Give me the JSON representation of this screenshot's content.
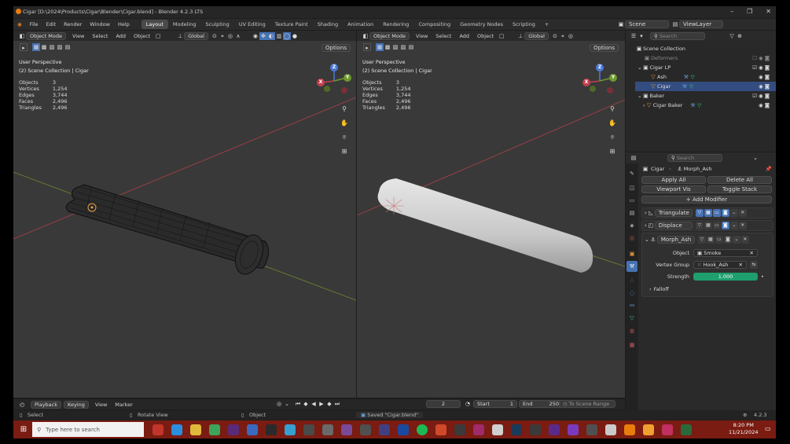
{
  "window": {
    "title": "Cigar [D:\\2024\\Products\\Cigar\\Blender\\Cigar.blend] - Blender 4.2.3 LTS"
  },
  "menus": [
    "File",
    "Edit",
    "Render",
    "Window",
    "Help"
  ],
  "workspaces": [
    "Layout",
    "Modeling",
    "Sculpting",
    "UV Editing",
    "Texture Paint",
    "Shading",
    "Animation",
    "Rendering",
    "Compositing",
    "Geometry Nodes",
    "Scripting"
  ],
  "active_workspace": "Layout",
  "scene": {
    "name": "Scene",
    "view_layer": "ViewLayer"
  },
  "viewport_left": {
    "mode": "Object Mode",
    "menus": [
      "View",
      "Select",
      "Add",
      "Object"
    ],
    "transform": "Global",
    "options": "Options",
    "perspective": "User Perspective",
    "collection": "(2) Scene Collection | Cigar",
    "stats": [
      [
        "Objects",
        "3"
      ],
      [
        "Vertices",
        "1,254"
      ],
      [
        "Edges",
        "3,744"
      ],
      [
        "Faces",
        "2,496"
      ],
      [
        "Triangles",
        "2,496"
      ]
    ]
  },
  "viewport_right": {
    "mode": "Object Mode",
    "menus": [
      "View",
      "Select",
      "Add",
      "Object"
    ],
    "transform": "Global",
    "options": "Options",
    "perspective": "User Perspective",
    "collection": "(2) Scene Collection | Cigar",
    "stats": [
      [
        "Objects",
        "3"
      ],
      [
        "Vertices",
        "1,254"
      ],
      [
        "Edges",
        "3,744"
      ],
      [
        "Faces",
        "2,496"
      ],
      [
        "Triangles",
        "2,496"
      ]
    ]
  },
  "gizmo_labels": {
    "x": "X",
    "y": "Y",
    "z": "Z"
  },
  "outliner": {
    "search_placeholder": "Search",
    "items": [
      {
        "label": "Scene Collection",
        "indent": 0
      },
      {
        "label": "Deformers",
        "indent": 1
      },
      {
        "label": "Cigar LP",
        "indent": 1
      },
      {
        "label": "Ash",
        "indent": 2
      },
      {
        "label": "Cigar",
        "indent": 2
      },
      {
        "label": "Baker",
        "indent": 1
      },
      {
        "label": "Cigar Baker",
        "indent": 2
      }
    ]
  },
  "properties": {
    "search_placeholder": "Search",
    "breadcrumb_object": "Cigar",
    "breadcrumb_modifier": "Morph_Ash",
    "apply_all": "Apply All",
    "delete_all": "Delete All",
    "viewport_vis": "Viewport Vis",
    "toggle_stack": "Toggle Stack",
    "add_modifier": "Add Modifier",
    "modifiers": [
      "Triangulate",
      "Displace",
      "Morph_Ash"
    ],
    "object_label": "Object",
    "object_value": "Smoke",
    "vgroup_label": "Vertex Group",
    "vgroup_value": "Hook_Ash",
    "strength_label": "Strength",
    "strength_value": "1.000",
    "falloff": "Falloff"
  },
  "timeline": {
    "menus": [
      "Playback",
      "Keying",
      "View",
      "Marker"
    ],
    "current_frame": "2",
    "start_label": "Start",
    "start": "1",
    "end_label": "End",
    "end": "250",
    "to_scene_range": "To Scene Range"
  },
  "statusbar": {
    "select": "Select",
    "rotate": "Rotate View",
    "object": "Object",
    "saved": "Saved \"Cigar.blend\"",
    "version": "4.2.3"
  },
  "taskbar": {
    "search_placeholder": "Type here to search",
    "time": "8:20 PM",
    "date": "11/21/2024"
  },
  "colors": {
    "accent": "#4772b3",
    "strength_bar": "#1f9e6e",
    "taskbar": "#7a1c12",
    "viewport": "#393939",
    "axis_x": "#b04048",
    "axis_y": "#6e8a2e"
  }
}
